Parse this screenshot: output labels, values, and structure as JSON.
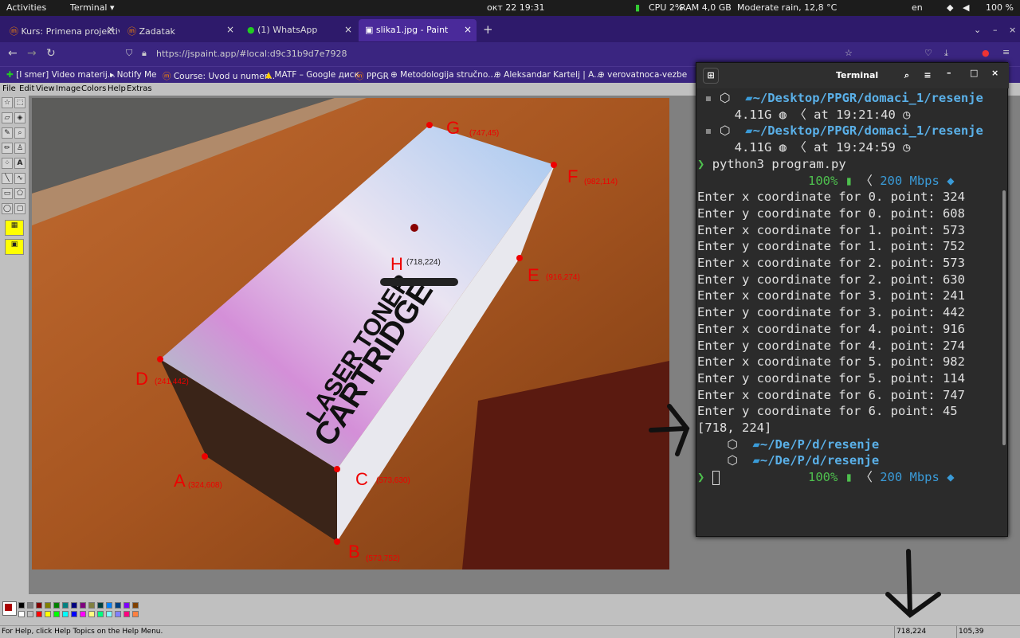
{
  "topbar": {
    "activities": "Activities",
    "app": "Terminal",
    "datetime": "окт 22  19:31",
    "cpu": "CPU 2%",
    "ram": "RAM 4,0 GB",
    "weather": "Moderate rain, 12,8 °C",
    "lang": "en",
    "battery": "100 %"
  },
  "tabs": [
    {
      "label": "Kurs: Primena projektivn"
    },
    {
      "label": "Zadatak"
    },
    {
      "label": "(1) WhatsApp"
    },
    {
      "label": "slika1.jpg - Paint"
    }
  ],
  "nav": {
    "url": "https://jspaint.app/#local:d9c31b9d7e7928"
  },
  "bookmarks": [
    "[I smer] Video materij...",
    "Notify Me",
    "Course: Uvod u numer...",
    "MATF – Google диск",
    "PPGR",
    "Metodologija stručno...",
    "Aleksandar Kartelj | A...",
    "verovatnoca-vezbe"
  ],
  "paint_menu": [
    "File",
    "Edit",
    "View",
    "Image",
    "Colors",
    "Help",
    "Extras"
  ],
  "image": {
    "points": [
      {
        "label": "G",
        "coord": "(747,45)"
      },
      {
        "label": "F",
        "coord": "(982,114)"
      },
      {
        "label": "H",
        "coord": "(718,224)"
      },
      {
        "label": "E",
        "coord": "(916,274)"
      },
      {
        "label": "D",
        "coord": "(241,442)"
      },
      {
        "label": "A",
        "coord": "(324,608)"
      },
      {
        "label": "C",
        "coord": "(573,630)"
      },
      {
        "label": "B",
        "coord": "(573,752)"
      }
    ],
    "box_text1": "LASER TONER",
    "box_text2": "CARTRIDGE"
  },
  "status": {
    "help": "For Help, click Help Topics on the Help Menu.",
    "cursor": "718,224",
    "size": "105,39"
  },
  "terminal": {
    "title": "Terminal",
    "path_full": "~/Desktop/PPGR/domaci_1/resenje",
    "mem": "4.11G",
    "time1": "at 19:21:40",
    "time2": "at 19:24:59",
    "command": "python3 program.py",
    "battery": "100%",
    "speed": "200 Mbps",
    "output": [
      "Enter x coordinate for 0. point: 324",
      "Enter y coordinate for 0. point: 608",
      "Enter x coordinate for 1. point: 573",
      "Enter y coordinate for 1. point: 752",
      "Enter x coordinate for 2. point: 573",
      "Enter y coordinate for 2. point: 630",
      "Enter x coordinate for 3. point: 241",
      "Enter y coordinate for 3. point: 442",
      "Enter x coordinate for 4. point: 916",
      "Enter y coordinate for 4. point: 274",
      "Enter x coordinate for 5. point: 982",
      "Enter y coordinate for 5. point: 114",
      "Enter x coordinate for 6. point: 747",
      "Enter y coordinate for 6. point: 45",
      "[718, 224]"
    ],
    "path_short": "~/De/P/d/resenje"
  }
}
